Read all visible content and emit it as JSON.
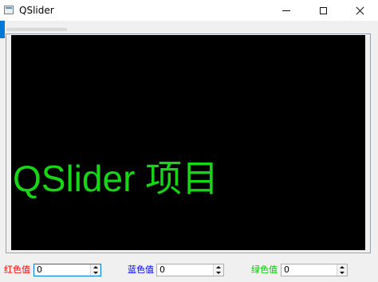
{
  "window": {
    "title": "QSlider",
    "icon": "app-window-icon"
  },
  "display": {
    "text": "QSlider 项目",
    "text_color": "#17d617",
    "background": "#000000"
  },
  "controls": {
    "red": {
      "label": "红色值",
      "value": "0",
      "label_color": "#ff0000"
    },
    "blue": {
      "label": "蓝色值",
      "value": "0",
      "label_color": "#0000ff"
    },
    "green": {
      "label": "绿色值",
      "value": "0",
      "label_color": "#00cc00"
    }
  },
  "colors": {
    "accent": "#0078d7"
  }
}
